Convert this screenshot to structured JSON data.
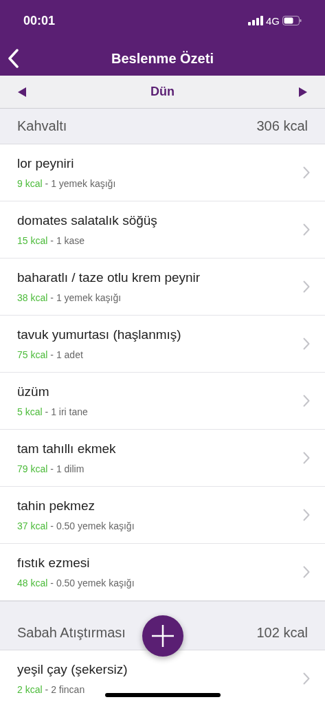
{
  "status_bar": {
    "time": "00:01",
    "network": "4G"
  },
  "nav": {
    "title": "Beslenme Özeti"
  },
  "date_bar": {
    "label": "Dün"
  },
  "meals": [
    {
      "name": "Kahvaltı",
      "total": "306 kcal",
      "items": [
        {
          "name": "lor peyniri",
          "kcal": "9 kcal",
          "amount": "- 1 yemek kaşığı"
        },
        {
          "name": "domates salatalık söğüş",
          "kcal": "15 kcal",
          "amount": "- 1 kase"
        },
        {
          "name": "baharatlı / taze otlu krem peynir",
          "kcal": "38 kcal",
          "amount": "- 1 yemek kaşığı"
        },
        {
          "name": "tavuk yumurtası (haşlanmış)",
          "kcal": "75 kcal",
          "amount": "- 1 adet"
        },
        {
          "name": "üzüm",
          "kcal": "5 kcal",
          "amount": "- 1 iri tane"
        },
        {
          "name": "tam tahıllı ekmek",
          "kcal": "79 kcal",
          "amount": "- 1 dilim"
        },
        {
          "name": "tahin pekmez",
          "kcal": "37 kcal",
          "amount": "- 0.50 yemek kaşığı"
        },
        {
          "name": "fıstık ezmesi",
          "kcal": "48 kcal",
          "amount": "- 0.50 yemek kaşığı"
        }
      ]
    },
    {
      "name": "Sabah Atıştırması",
      "total": "102 kcal",
      "items": [
        {
          "name": "yeşil çay (şekersiz)",
          "kcal": "2 kcal",
          "amount": "- 2 fincan"
        }
      ]
    }
  ]
}
